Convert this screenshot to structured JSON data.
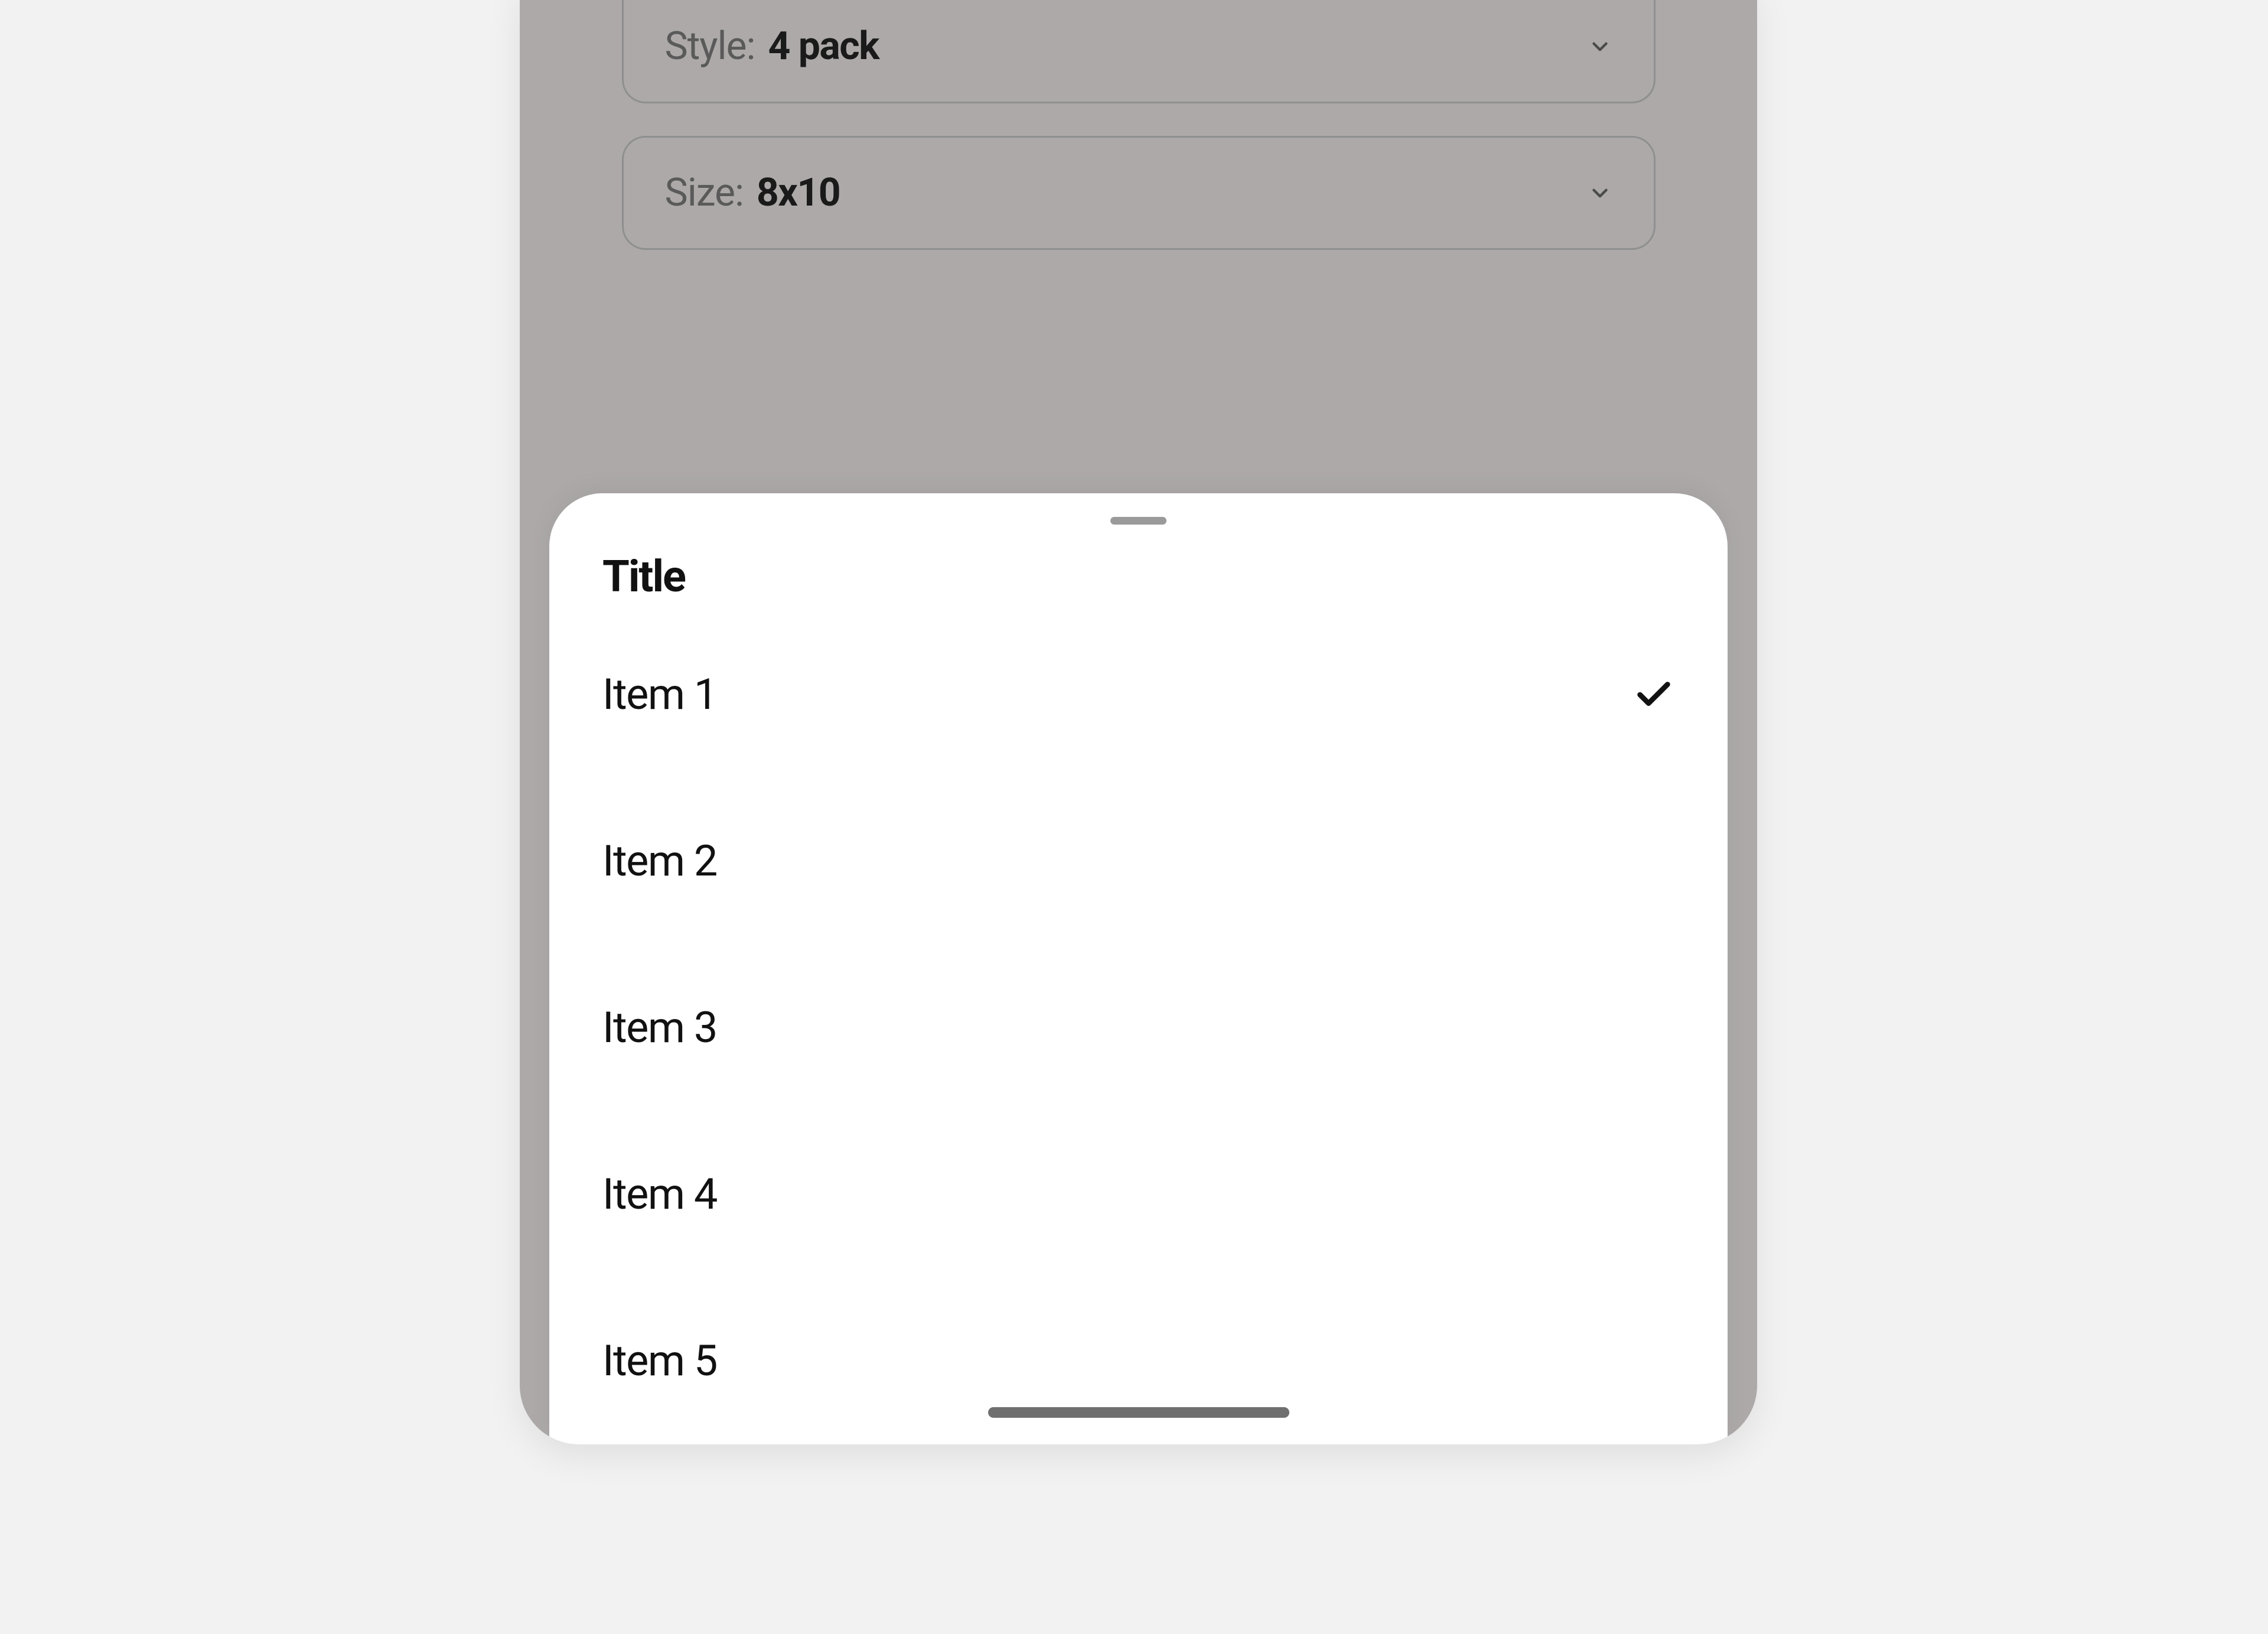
{
  "selectors": [
    {
      "label": "Style:",
      "value": "4 pack"
    },
    {
      "label": "Size:",
      "value": "8x10"
    }
  ],
  "sheet": {
    "title": "Title",
    "items": [
      {
        "label": "Item 1",
        "selected": true
      },
      {
        "label": "Item 2",
        "selected": false
      },
      {
        "label": "Item 3",
        "selected": false
      },
      {
        "label": "Item 4",
        "selected": false
      },
      {
        "label": "Item 5",
        "selected": false
      }
    ]
  }
}
